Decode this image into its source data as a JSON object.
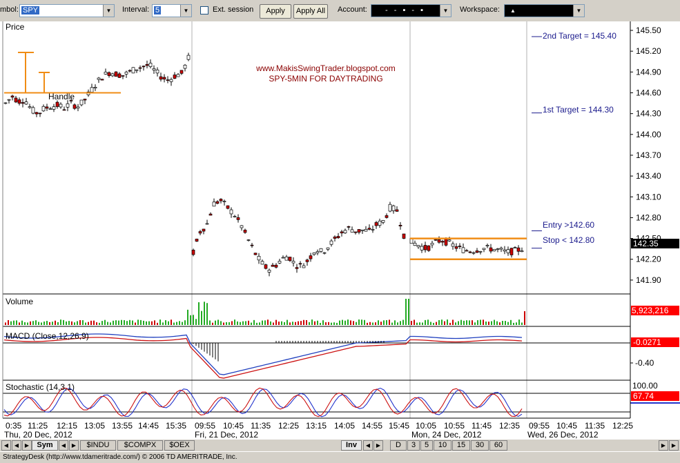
{
  "toolbar": {
    "symbol_label": "mbol:",
    "symbol_value": "SPY",
    "interval_label": "Interval:",
    "interval_value": "5",
    "ext_session_label": "Ext. session",
    "apply_label": "Apply",
    "apply_all_label": "Apply All",
    "account_label": "Account:",
    "account_value": "- - ▪ - ▪",
    "workspace_label": "Workspace:",
    "workspace_value": "▲"
  },
  "colors": {
    "up_candle": "#ffffff",
    "down_candle": "#cc0000",
    "volume_bar": "#22aa22",
    "target_line": "#1a1a8c",
    "box_line": "#f08c14",
    "macd_line": "#1f3fbf",
    "macd_signal": "#cc1111",
    "stoch_k": "#2233cc",
    "stoch_d": "#cc1111",
    "badge_red": "#ff0000"
  },
  "chart": {
    "price_panel_title": "Price",
    "watermark_line1": "www.MakisSwingTrader.blogspot.com",
    "watermark_line2": "SPY-5MIN FOR DAYTRADING",
    "handle_label": "Handle",
    "targets": [
      {
        "label": "2nd Target = 145.40",
        "price": 145.4
      },
      {
        "label": "1st Target = 144.30",
        "price": 144.3
      },
      {
        "label": "Entry >142.60",
        "price": 142.6
      },
      {
        "label": "Stop < 142.80",
        "price": 142.35
      }
    ],
    "current_price_badge": "142.35",
    "volume_title": "Volume",
    "volume_badge": "5,923,216",
    "macd_title": "MACD (Close,12,26,9)",
    "macd_badge": "-0.0271",
    "macd_tick": "-0.40",
    "stoch_title": "Stochastic (14,3,1)",
    "stoch_badge": "67.74",
    "stoch_tick_top": "100.00",
    "time_labels": [
      "0:35",
      "11:25",
      "12:15",
      "13:05",
      "13:55",
      "14:45",
      "15:35",
      "09:55",
      "10:45",
      "11:35",
      "12:25",
      "13:15",
      "14:05",
      "14:55",
      "15:45",
      "10:05",
      "10:55",
      "11:45",
      "12:35",
      "09:55",
      "10:45",
      "11:35",
      "12:25"
    ],
    "date_labels": [
      "Thu, 20 Dec, 2012",
      "Fri, 21 Dec, 2012",
      "Mon, 24 Dec, 2012",
      "Wed, 26 Dec, 2012"
    ]
  },
  "chart_data": {
    "type": "candlestick",
    "symbol": "SPY",
    "interval": "5",
    "y_ticks": [
      "145.50",
      "145.20",
      "144.90",
      "144.60",
      "144.30",
      "144.00",
      "143.70",
      "143.40",
      "143.10",
      "142.80",
      "142.50",
      "142.20",
      "141.90"
    ],
    "ylim": [
      141.7,
      145.55
    ],
    "sessions": [
      {
        "date": "Thu, 20 Dec, 2012",
        "open": 144.55,
        "close": 145.1,
        "low": 144.25,
        "high": 145.15
      },
      {
        "date": "Fri, 21 Dec, 2012",
        "open": 142.2,
        "close": 142.65,
        "low": 141.95,
        "high": 143.1
      },
      {
        "date": "Mon, 24 Dec, 2012",
        "open": 142.5,
        "close": 142.35,
        "low": 142.2,
        "high": 142.55
      }
    ],
    "annotations": {
      "handle_level": 144.6,
      "consolidation_box": [
        142.2,
        142.5
      ],
      "targets": [
        145.4,
        144.3
      ],
      "entry": 142.6,
      "stop": 142.8
    },
    "volume_last": 5923216,
    "macd_last": -0.0271,
    "stochastic_last": 67.74
  },
  "bottom_bar": {
    "sym_tab": "Sym",
    "tabs": [
      "$INDU",
      "$COMPX",
      "$OEX"
    ],
    "inv_tab": "Inv",
    "interval_tabs": [
      "D",
      "3",
      "5",
      "10",
      "15",
      "30",
      "60"
    ]
  },
  "status": "StrategyDesk (http://www.tdameritrade.com/) © 2006 TD AMERITRADE, Inc."
}
